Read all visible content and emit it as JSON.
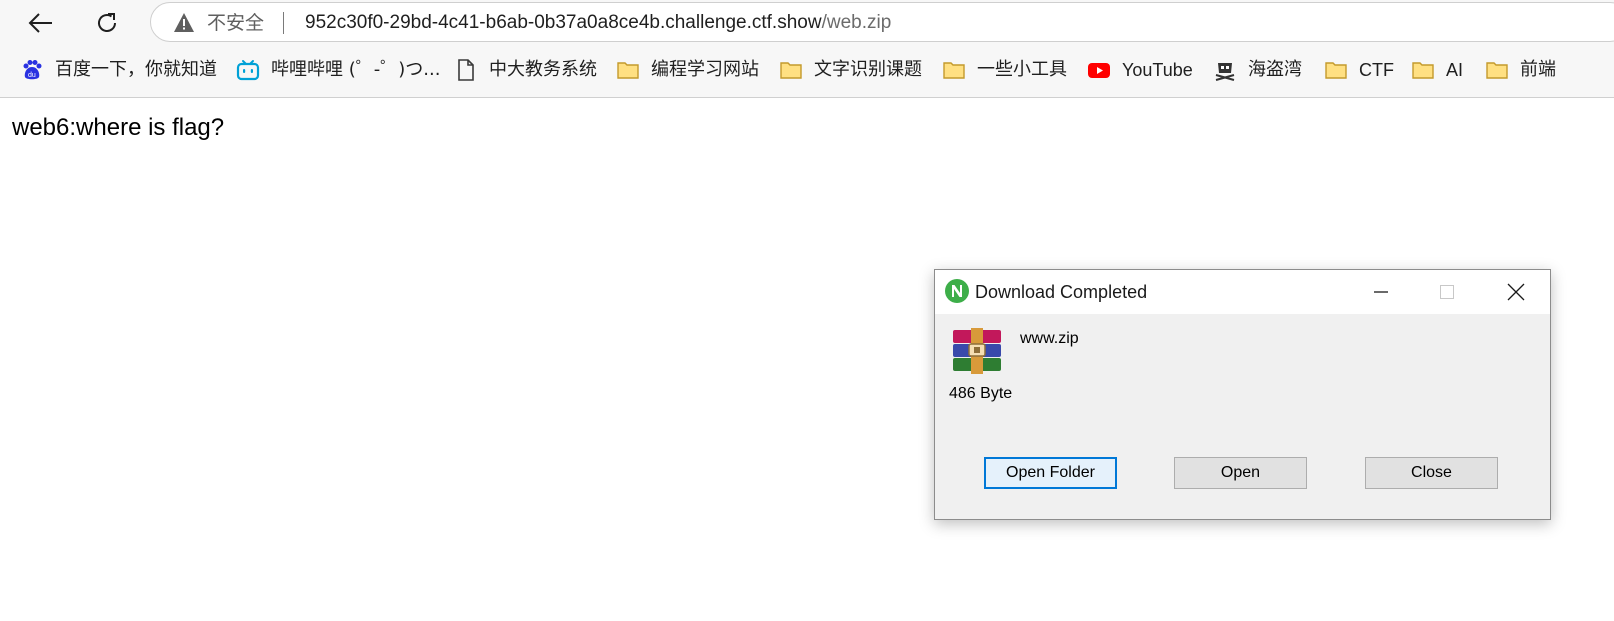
{
  "browser": {
    "address_bar": {
      "security_label": "不安全",
      "url_host": "952c30f0-29bd-4c41-b6ab-0b37a0a8ce4b.challenge.ctf.show",
      "url_path": "/web.zip"
    },
    "bookmarks": [
      {
        "label": "百度一下，你就知道",
        "icon": "baidu-icon"
      },
      {
        "label": "哔哩哔哩 (゜-゜)つ...",
        "icon": "bilibili-icon"
      },
      {
        "label": "中大教务系统",
        "icon": "page-icon"
      },
      {
        "label": "编程学习网站",
        "icon": "folder-icon"
      },
      {
        "label": "文字识别课题",
        "icon": "folder-icon"
      },
      {
        "label": "一些小工具",
        "icon": "folder-icon"
      },
      {
        "label": "YouTube",
        "icon": "youtube-icon"
      },
      {
        "label": "海盗湾",
        "icon": "pirate-icon"
      },
      {
        "label": "CTF",
        "icon": "folder-icon"
      },
      {
        "label": "AI",
        "icon": "folder-icon"
      },
      {
        "label": "前端",
        "icon": "folder-icon"
      }
    ]
  },
  "page": {
    "heading": "web6:where is flag?"
  },
  "download_dialog": {
    "title": "Download Completed",
    "file_name": "www.zip",
    "file_size": "486 Byte",
    "buttons": {
      "open_folder": "Open Folder",
      "open": "Open",
      "close": "Close"
    },
    "accent_color": "#0078d7"
  }
}
